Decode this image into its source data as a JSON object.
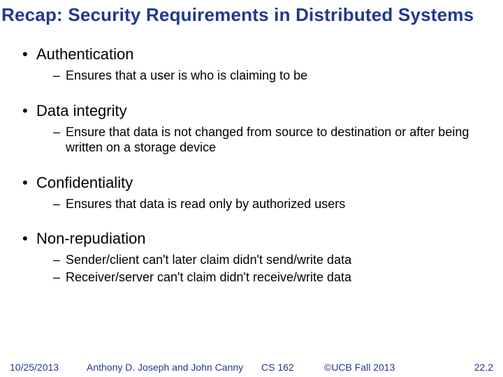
{
  "title": "Recap: Security Requirements in Distributed Systems",
  "items": [
    {
      "label": "Authentication",
      "subs": [
        "Ensures that a user is who is claiming to be"
      ]
    },
    {
      "label": "Data integrity",
      "subs": [
        "Ensure that data is not changed from source to destination or after being written on a storage device"
      ]
    },
    {
      "label": "Confidentiality",
      "subs": [
        "Ensures that data is read only by authorized users"
      ]
    },
    {
      "label": "Non-repudiation",
      "subs": [
        "Sender/client can't later claim didn't send/write data",
        "Receiver/server can't claim didn't receive/write data"
      ]
    }
  ],
  "footer": {
    "date": "10/25/2013",
    "authors": "Anthony D. Joseph and John Canny",
    "course": "CS 162",
    "copyright": "©UCB Fall 2013",
    "page": "22.2"
  }
}
